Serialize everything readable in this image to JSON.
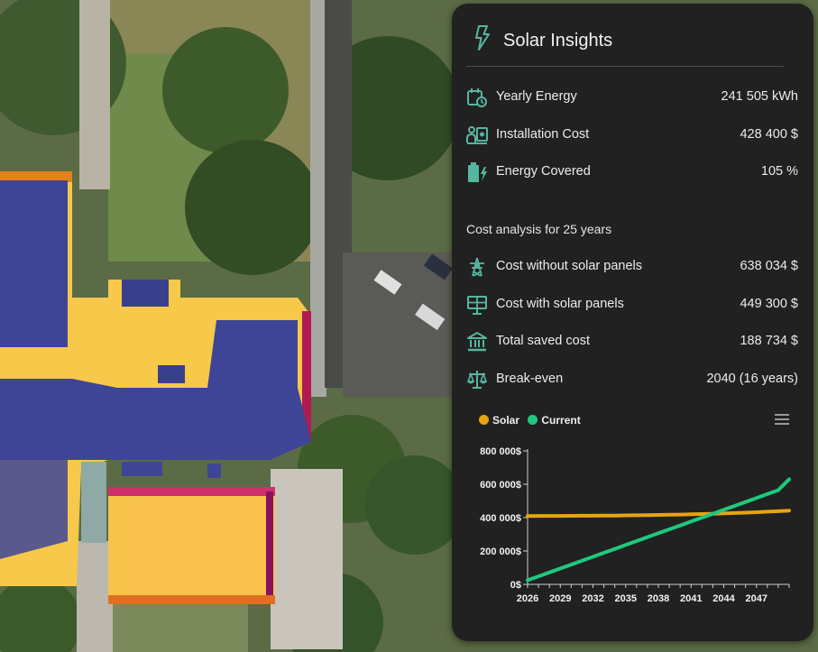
{
  "panel": {
    "title": "Solar Insights",
    "title_icon": "lightning-bolt-icon",
    "accent_color": "#56b6a0",
    "rows": [
      {
        "icon": "calendar-energy-icon",
        "label": "Yearly Energy",
        "value": "241 505 kWh"
      },
      {
        "icon": "installation-cost-icon",
        "label": "Installation Cost",
        "value": "428 400 $"
      },
      {
        "icon": "battery-charging-icon",
        "label": "Energy Covered",
        "value": "105 %"
      }
    ],
    "section_title": "Cost analysis for 25 years",
    "cost_rows": [
      {
        "icon": "power-tower-icon",
        "label": "Cost without solar panels",
        "value": "638 034 $"
      },
      {
        "icon": "solar-panel-icon",
        "label": "Cost with solar panels",
        "value": "449 300 $"
      },
      {
        "icon": "bank-icon",
        "label": "Total saved cost",
        "value": "188 734 $"
      },
      {
        "icon": "scale-balance-icon",
        "label": "Break-even",
        "value": "2040 (16 years)"
      }
    ]
  },
  "chart_data": {
    "type": "line",
    "title": "",
    "xlabel": "",
    "ylabel": "",
    "x": [
      2026,
      2027,
      2028,
      2029,
      2030,
      2031,
      2032,
      2033,
      2034,
      2035,
      2036,
      2037,
      2038,
      2039,
      2040,
      2041,
      2042,
      2043,
      2044,
      2045,
      2046,
      2047,
      2048,
      2049,
      2050
    ],
    "x_tick_labels": [
      "2026",
      "2029",
      "2032",
      "2035",
      "2038",
      "2041",
      "2044",
      "2047"
    ],
    "y_tick_labels": [
      "0$",
      "200 000$",
      "400 000$",
      "600 000$",
      "800 000$"
    ],
    "y_ticks": [
      0,
      200000,
      400000,
      600000,
      800000
    ],
    "ylim": [
      0,
      800000
    ],
    "legend_position": "top-left",
    "grid": false,
    "series": [
      {
        "name": "Solar",
        "color": "#e8a40f",
        "values": [
          410000,
          410100,
          410300,
          410500,
          410800,
          411100,
          411500,
          412000,
          412600,
          413300,
          414100,
          415000,
          416000,
          417200,
          418500,
          420000,
          421600,
          423400,
          425400,
          427600,
          430000,
          432600,
          435500,
          438600,
          442000
        ]
      },
      {
        "name": "Current",
        "color": "#1ec97e",
        "values": [
          25000,
          48000,
          71500,
          95000,
          118500,
          142000,
          165500,
          189000,
          212500,
          236000,
          259500,
          283000,
          306500,
          330000,
          353000,
          376500,
          400000,
          423500,
          447000,
          470500,
          494000,
          517500,
          541000,
          564500,
          630000
        ]
      }
    ]
  }
}
